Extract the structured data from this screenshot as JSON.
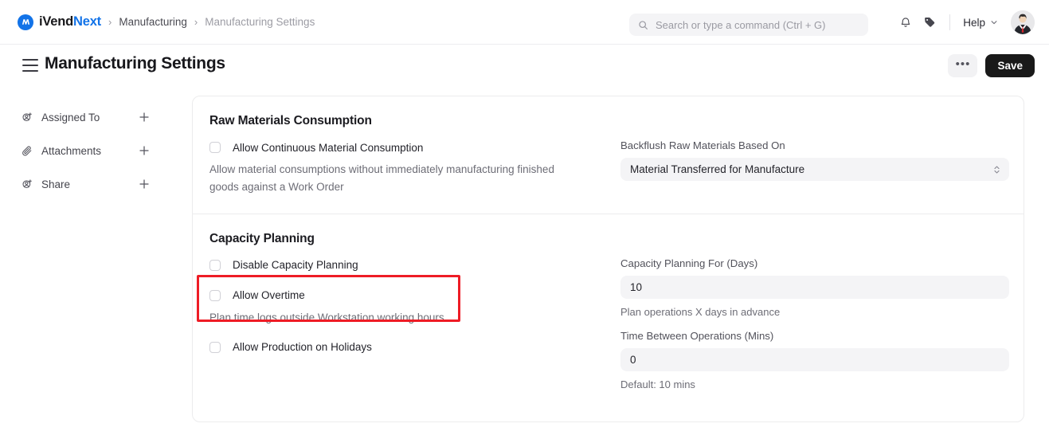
{
  "navbar": {
    "brand": {
      "text_first": "iVend",
      "text_second": "Next",
      "logo_icon": "ivendnext-logo-icon",
      "brand_color": "#1273e8"
    },
    "breadcrumbs": [
      {
        "label": "Manufacturing",
        "current": false
      },
      {
        "label": "Manufacturing Settings",
        "current": true
      }
    ],
    "separator": "›",
    "search": {
      "placeholder": "Search or type a command (Ctrl + G)",
      "value": "",
      "icon": "search-icon"
    },
    "notifications_icon": "bell-icon",
    "tags_icon": "tag-icon",
    "help": {
      "label": "Help",
      "chevron_icon": "chevron-down-icon"
    },
    "avatar_icon": "user-avatar"
  },
  "page_header": {
    "menu_icon": "hamburger-menu-icon",
    "title": "Manufacturing Settings",
    "more_label": "•••",
    "save_label": "Save"
  },
  "sidebar": {
    "items": [
      {
        "label": "Assigned To",
        "icon": "user-plus-icon",
        "action_icon": "plus-icon"
      },
      {
        "label": "Attachments",
        "icon": "paperclip-icon",
        "action_icon": "plus-icon"
      },
      {
        "label": "Share",
        "icon": "user-plus-icon",
        "action_icon": "plus-icon"
      }
    ]
  },
  "sections": [
    {
      "title": "Raw Materials Consumption",
      "checkboxes": [
        {
          "label": "Allow Continuous Material Consumption",
          "checked": false,
          "description": "Allow material consumptions without immediately manufacturing finished goods against a Work Order"
        }
      ],
      "fields": [
        {
          "label": "Backflush Raw Materials Based On",
          "value": "Material Transferred for Manufacture",
          "type": "select",
          "help": ""
        }
      ]
    },
    {
      "title": "Capacity Planning",
      "checkboxes": [
        {
          "label": "Disable Capacity Planning",
          "checked": false,
          "description": ""
        },
        {
          "label": "Allow Overtime",
          "checked": false,
          "description": "Plan time logs outside Workstation working hours"
        },
        {
          "label": "Allow Production on Holidays",
          "checked": false,
          "description": ""
        }
      ],
      "fields": [
        {
          "label": "Capacity Planning For (Days)",
          "value": "10",
          "type": "text",
          "help": "Plan operations X days in advance"
        },
        {
          "label": "Time Between Operations (Mins)",
          "value": "0",
          "type": "text",
          "help": "Default: 10 mins"
        }
      ]
    }
  ],
  "annotation": {
    "color": "#ee1c25",
    "target": "allow-overtime-checkbox-group"
  }
}
